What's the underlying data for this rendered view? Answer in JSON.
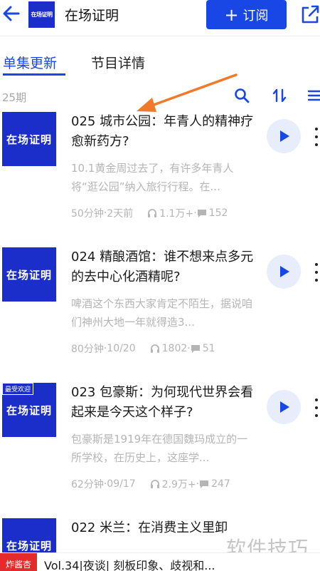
{
  "header": {
    "logo_text": "在场证明",
    "title": "在场证明",
    "subscribe_label": "订阅",
    "accent_color": "#1947e6"
  },
  "tabs": [
    {
      "label": "单集更新",
      "active": true
    },
    {
      "label": "节目详情",
      "active": false
    }
  ],
  "toolbar": {
    "episode_count": "25期",
    "icons": [
      "search-icon",
      "sort-icon",
      "filter-icon"
    ]
  },
  "episodes": [
    {
      "cover_text": "在场证明",
      "badge": "",
      "title": "025 城市公园：年青人的精神疗愈新药方?",
      "description": "10.1黄金周过去了，有许多年青人将“逛公园”纳入旅行行程。在...",
      "duration": "50分钟",
      "date": "2天前",
      "plays": "1.1万+",
      "comments": "152"
    },
    {
      "cover_text": "在场证明",
      "badge": "",
      "title": "024 精酿酒馆：谁不想来点多元的去中心化酒精呢?",
      "description": "啤酒这个东西大家肯定不陌生，据说咱们神州大地一年就得造3...",
      "duration": "80分钟",
      "date": "10/20",
      "plays": "1802",
      "comments": "51"
    },
    {
      "cover_text": "在场证明",
      "badge": "最受欢迎",
      "title": "023 包豪斯：为何现代世界会看起来是今天这个样子?",
      "description": "包豪斯是1919年在德国魏玛成立的一所学校，在历史上，这座学...",
      "duration": "62分钟",
      "date": "09/17",
      "plays": "2.9万+",
      "comments": "247"
    },
    {
      "cover_text": "在场证明",
      "badge": "",
      "title": "022 米兰：在消费主义里卸",
      "description": "",
      "duration": "",
      "date": "",
      "plays": "",
      "comments": ""
    }
  ],
  "mini_player": {
    "cover_text": "炸酱杏",
    "title": "Vol.34|夜谈| 刻板印象、歧视和..."
  },
  "watermark": "软件技巧"
}
